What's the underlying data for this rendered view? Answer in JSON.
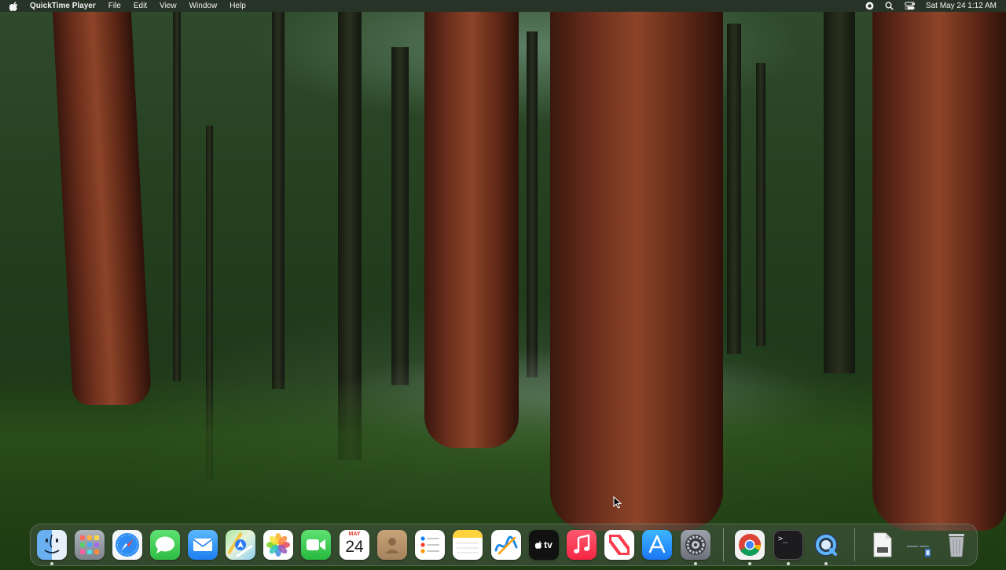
{
  "menubar": {
    "app_name": "QuickTime Player",
    "menus": [
      "File",
      "Edit",
      "View",
      "Window",
      "Help"
    ],
    "status_icons": [
      "screen-record-icon",
      "search-icon",
      "control-center-icon"
    ],
    "clock": "Sat May 24  1:12 AM"
  },
  "dock": {
    "apps": [
      {
        "name": "Finder",
        "icon": "finder-icon"
      },
      {
        "name": "Launchpad",
        "icon": "launchpad-icon"
      },
      {
        "name": "Safari",
        "icon": "safari-icon"
      },
      {
        "name": "Messages",
        "icon": "messages-icon"
      },
      {
        "name": "Mail",
        "icon": "mail-icon"
      },
      {
        "name": "Maps",
        "icon": "maps-icon"
      },
      {
        "name": "Photos",
        "icon": "photos-icon"
      },
      {
        "name": "FaceTime",
        "icon": "facetime-icon"
      },
      {
        "name": "Calendar",
        "icon": "calendar-icon",
        "month": "MAY",
        "day": "24"
      },
      {
        "name": "Contacts",
        "icon": "contacts-icon"
      },
      {
        "name": "Reminders",
        "icon": "reminders-icon"
      },
      {
        "name": "Notes",
        "icon": "notes-icon"
      },
      {
        "name": "Freeform",
        "icon": "freeform-icon"
      },
      {
        "name": "TV",
        "icon": "apple-tv-icon",
        "label": "tv"
      },
      {
        "name": "Music",
        "icon": "music-icon"
      },
      {
        "name": "News",
        "icon": "news-icon"
      },
      {
        "name": "App Store",
        "icon": "app-store-icon"
      },
      {
        "name": "System Settings",
        "icon": "system-settings-icon"
      },
      {
        "name": "Google Chrome",
        "icon": "chrome-icon"
      },
      {
        "name": "Terminal",
        "icon": "terminal-icon",
        "label": ">_"
      },
      {
        "name": "QuickTime Player",
        "icon": "quicktime-icon"
      },
      {
        "name": "Document",
        "icon": "document-icon"
      },
      {
        "name": "Downloads",
        "icon": "downloads-stack-icon"
      },
      {
        "name": "Trash",
        "icon": "trash-icon"
      }
    ]
  },
  "colors": {
    "menubar_bg": "#283028",
    "dock_bg": "#505c54",
    "wallpaper_green": "#25401f",
    "redwood": "#8c4428"
  }
}
